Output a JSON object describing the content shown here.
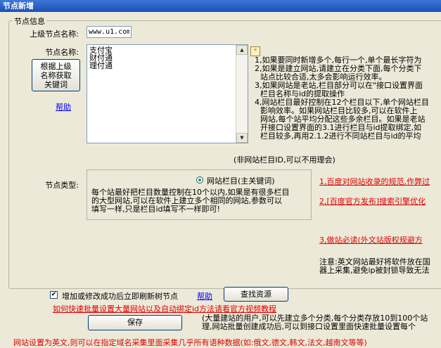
{
  "window": {
    "title": "节点新增"
  },
  "group": {
    "legend": "节点信息"
  },
  "parent": {
    "label": "上级节点名称:",
    "value": "www.u1.com"
  },
  "node_name": {
    "label": "节点名称:",
    "values": [
      "支付宝",
      "财付通",
      "理付通"
    ],
    "generate_button": [
      "根据上级",
      "名称获取",
      "关键词"
    ],
    "help_link": "帮助"
  },
  "tips": {
    "star": "*",
    "lines": [
      "1,如果要同时新增多个,每行一个,单个最长字符为",
      "2,如果是建立网站,请建立在分类下面,每个分类下",
      "站点比较合适,太多会影响运行效率。",
      "3,如果网站是老站,栏目部分可以在\"接口设置界面",
      "栏目名称与id的提取操作",
      "4,网站栏目最好控制在12个栏目以下,单个网站栏目",
      "影响效率。如果网站栏目比较多,可以在软件上",
      "网站,每个站平均分配这些多余栏目。如果是老站",
      "开接口设置界面的3.1进行栏目与id提取绑定,如",
      "栏目较多,再用2.1.2进行不同站栏目与id的平均"
    ],
    "note": "(非网站栏目ID,可以不用理会)"
  },
  "node_type": {
    "label": "节点类型:",
    "radio_label": "网站栏目(主关键词)",
    "description": [
      "每个站最好把栏目数量控制在10个以内,如果是有很多栏目",
      "的大型网站,可以在软件上建立多个相同的网站,参数可以",
      "填写一样,只是栏目id填写不一样即可!"
    ]
  },
  "right_links": {
    "link1": "1,百度对网站收录的规范,作弊过",
    "link2": "2,[百度官方发布]搜索引擎优化",
    "link3": "3,做站必读(外文站版权规避方",
    "note": [
      "注意:英文网站最好将软件放在国",
      "器上采集,避免ip被封锁导致无法"
    ]
  },
  "refresh": {
    "checked": true,
    "label": "增加或修改成功后立即刷新树节点",
    "help": "帮助"
  },
  "find_resource_button": "查找资源",
  "video_link": "如何快速批量设置大量网站以及自动绑定id方法请看官方视频教程",
  "save_button": "保存",
  "bottom_info": [
    "(大量建站的用户,可以先建立多个分类,每个分类存放10到100个站",
    "理,网站批量创建成功后,可以到接口设置里面快速批量设置每个"
  ],
  "bottom_warning": "网站设置为英文,则可以在指定域名采集里面采集几乎所有语种数据(如:俄文,德文,韩文,法文,越南文等等)"
}
